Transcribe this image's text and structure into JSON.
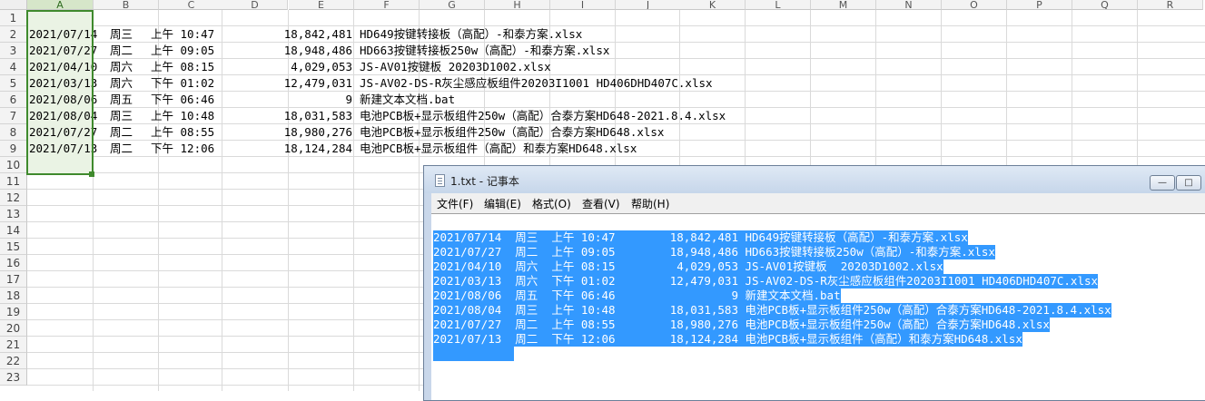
{
  "spreadsheet": {
    "columns": [
      "A",
      "B",
      "C",
      "D",
      "E",
      "F",
      "G",
      "H",
      "I",
      "J",
      "K",
      "L",
      "M",
      "N",
      "O",
      "P",
      "Q",
      "R"
    ],
    "row_numbers": [
      "1",
      "2",
      "3",
      "4",
      "5",
      "6",
      "7",
      "8",
      "9",
      "10",
      "11",
      "12",
      "13",
      "14",
      "15",
      "16",
      "17",
      "18",
      "19",
      "20",
      "21",
      "22",
      "23"
    ],
    "rows": [
      {
        "date": "2021/07/14",
        "weekday": "周三",
        "time": "上午 10:47",
        "size": "18,842,481",
        "name": "HD649按键转接板（高配）-和泰方案.xlsx"
      },
      {
        "date": "2021/07/27",
        "weekday": "周二",
        "time": "上午 09:05",
        "size": "18,948,486",
        "name": "HD663按键转接板250w（高配）-和泰方案.xlsx"
      },
      {
        "date": "2021/04/10",
        "weekday": "周六",
        "time": "上午 08:15",
        "size": "4,029,053",
        "name": "JS-AV01按键板  20203D1002.xlsx"
      },
      {
        "date": "2021/03/13",
        "weekday": "周六",
        "time": "下午 01:02",
        "size": "12,479,031",
        "name": "JS-AV02-DS-R灰尘感应板组件20203I1001 HD406DHD407C.xlsx"
      },
      {
        "date": "2021/08/06",
        "weekday": "周五",
        "time": "下午 06:46",
        "size": "9",
        "name": "新建文本文档.bat"
      },
      {
        "date": "2021/08/04",
        "weekday": "周三",
        "time": "上午 10:48",
        "size": "18,031,583",
        "name": "电池PCB板+显示板组件250w（高配）合泰方案HD648-2021.8.4.xlsx"
      },
      {
        "date": "2021/07/27",
        "weekday": "周二",
        "time": "上午 08:55",
        "size": "18,980,276",
        "name": "电池PCB板+显示板组件250w（高配）合泰方案HD648.xlsx"
      },
      {
        "date": "2021/07/13",
        "weekday": "周二",
        "time": "下午 12:06",
        "size": "18,124,284",
        "name": "电池PCB板+显示板组件（高配）和泰方案HD648.xlsx"
      }
    ]
  },
  "notepad": {
    "title": "1.txt - 记事本",
    "menu": [
      "文件(F)",
      "编辑(E)",
      "格式(O)",
      "查看(V)",
      "帮助(H)"
    ],
    "lines": [
      "2021/07/14  周三  上午 10:47        18,842,481 HD649按键转接板（高配）-和泰方案.xlsx",
      "2021/07/27  周二  上午 09:05        18,948,486 HD663按键转接板250w（高配）-和泰方案.xlsx",
      "2021/04/10  周六  上午 08:15         4,029,053 JS-AV01按键板  20203D1002.xlsx",
      "2021/03/13  周六  下午 01:02        12,479,031 JS-AV02-DS-R灰尘感应板组件20203I1001 HD406DHD407C.xlsx",
      "2021/08/06  周五  下午 06:46                 9 新建文本文档.bat",
      "2021/08/04  周三  上午 10:48        18,031,583 电池PCB板+显示板组件250w（高配）合泰方案HD648-2021.8.4.xlsx",
      "2021/07/27  周二  上午 08:55        18,980,276 电池PCB板+显示板组件250w（高配）合泰方案HD648.xlsx",
      "2021/07/13  周二  下午 12:06        18,124,284 电池PCB板+显示板组件（高配）和泰方案HD648.xlsx"
    ],
    "selection_color": "#3399ff"
  },
  "colors": {
    "selection_green": "#3f8a2d",
    "header_bg": "#f3f3f3"
  }
}
